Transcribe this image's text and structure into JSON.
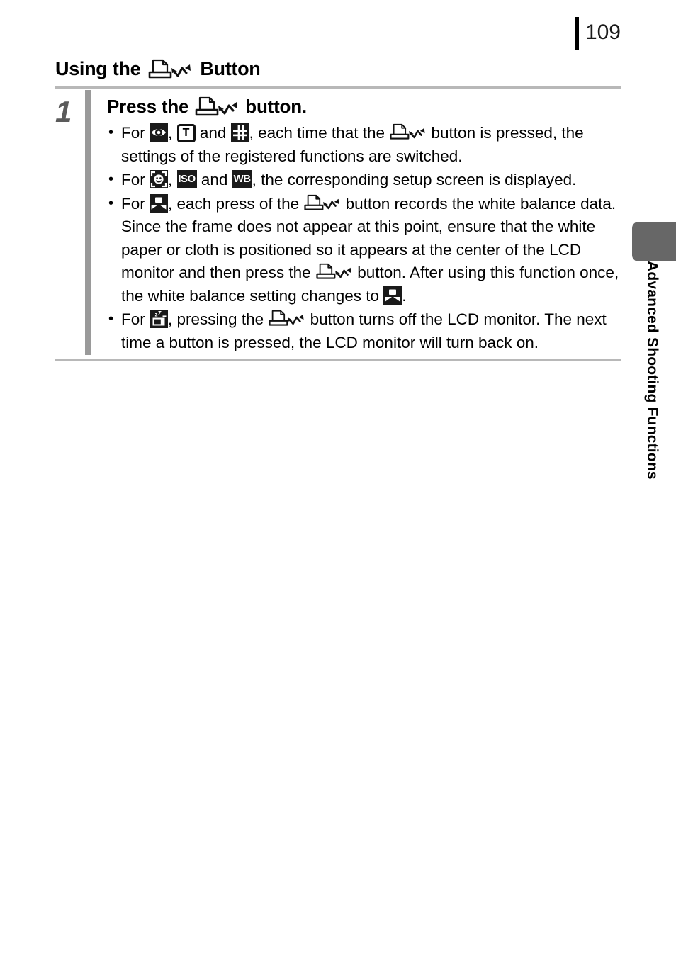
{
  "page": {
    "number": "109",
    "section_title_prefix": "Using the",
    "section_title_suffix": "Button"
  },
  "step": {
    "number": "1",
    "heading_prefix": "Press the",
    "heading_suffix": "button.",
    "bullets": [
      {
        "id": "bullet-registered-functions",
        "lead": "For",
        "icons": [
          "red-eye-icon",
          "digital-tele-converter-icon",
          "grid-lines-icon"
        ],
        "separators": [
          ",",
          "and"
        ],
        "text_after_icons": ", each time that the",
        "icon_mid": "print-share-icon",
        "text_tail": "button is pressed, the settings of the registered functions are switched."
      },
      {
        "id": "bullet-setup-screen",
        "lead": "For",
        "icons": [
          "face-select-icon",
          "iso-icon",
          "white-balance-icon"
        ],
        "separators": [
          ",",
          "and"
        ],
        "text_after_icons": ", the corresponding setup screen is displayed."
      },
      {
        "id": "bullet-custom-white-balance",
        "lead": "For",
        "icons": [
          "custom-white-balance-icon"
        ],
        "text_part_1": ", each press of the",
        "icon_mid_1": "print-share-icon",
        "text_part_2": "button records the white balance data. Since the frame does not appear at this point, ensure that the white paper or cloth is positioned so it appears at the center of the LCD monitor and then press the",
        "icon_mid_2": "print-share-icon",
        "text_part_3": "button. After using this function once, the white balance setting changes to",
        "icon_mid_3": "custom-white-balance-icon",
        "text_part_4": "."
      },
      {
        "id": "bullet-lcd-off",
        "lead": "For",
        "icons": [
          "display-off-icon"
        ],
        "text_part_1": ", pressing the",
        "icon_mid_1": "print-share-icon",
        "text_part_2": "button turns off the LCD monitor. The next time a button is pressed, the LCD monitor will turn back on."
      }
    ]
  },
  "side_tab": {
    "label": "Advanced Shooting Functions",
    "color": "#676767"
  },
  "colors": {
    "rule": "#b8b8b8",
    "step_divider": "#9a9a9a",
    "step_number": "#5b5b5b",
    "icon_fill": "#1a1a1a",
    "text": "#000000"
  }
}
